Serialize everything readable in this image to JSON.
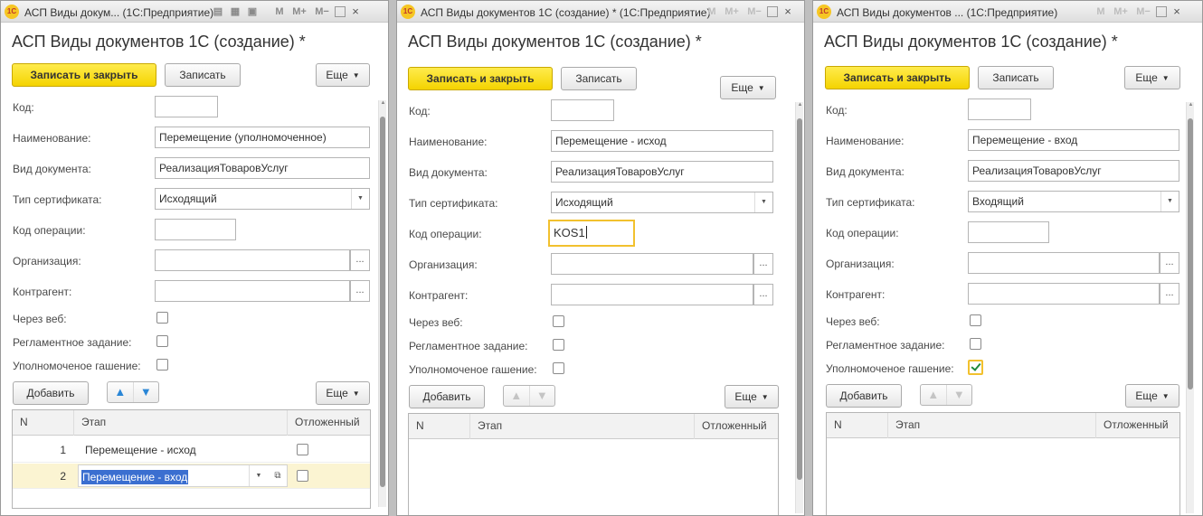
{
  "windows": [
    {
      "title_text": "АСП Виды докум...  (1С:Предприятие)",
      "form_title": "АСП Виды документов 1С (создание) *",
      "btn_save_close": "Записать и закрыть",
      "btn_save": "Записать",
      "btn_more": "Еще",
      "labels": {
        "code": "Код:",
        "name": "Наименование:",
        "doc_type": "Вид документа:",
        "cert_type": "Тип сертификата:",
        "op_code": "Код операции:",
        "org": "Организация:",
        "contractor": "Контрагент:",
        "via_web": "Через веб:",
        "scheduled": "Регламентное задание:",
        "auth_cancel": "Уполномоченое гашение:"
      },
      "values": {
        "code": "",
        "name": "Перемещение (уполномоченное)",
        "doc_type": "РеализацияТоваровУслуг",
        "cert_type": "Исходящий",
        "op_code": "",
        "org": "",
        "contractor": ""
      },
      "checks": {
        "via_web": false,
        "scheduled": false,
        "auth_cancel": false
      },
      "btn_add": "Добавить",
      "table": {
        "headers": [
          "N",
          "Этап",
          "Отложенный"
        ],
        "rows": [
          {
            "n": "1",
            "etap": "Перемещение - исход",
            "delayed": false
          },
          {
            "n": "2",
            "etap": "Перемещение - вход",
            "delayed": false
          }
        ]
      }
    },
    {
      "title_text": "АСП Виды документов 1С (создание) *  (1С:Предприятие)",
      "form_title": "АСП Виды документов 1С (создание) *",
      "btn_save_close": "Записать и закрыть",
      "btn_save": "Записать",
      "btn_more": "Еще",
      "labels": {
        "code": "Код:",
        "name": "Наименование:",
        "doc_type": "Вид документа:",
        "cert_type": "Тип сертификата:",
        "op_code": "Код операции:",
        "org": "Организация:",
        "contractor": "Контрагент:",
        "via_web": "Через веб:",
        "scheduled": "Регламентное задание:",
        "auth_cancel": "Уполномоченое гашение:"
      },
      "values": {
        "code": "",
        "name": "Перемещение - исход",
        "doc_type": "РеализацияТоваровУслуг",
        "cert_type": "Исходящий",
        "op_code": "KOS1",
        "org": "",
        "contractor": ""
      },
      "checks": {
        "via_web": false,
        "scheduled": false,
        "auth_cancel": false
      },
      "btn_add": "Добавить",
      "table": {
        "headers": [
          "N",
          "Этап",
          "Отложенный"
        ],
        "rows": []
      }
    },
    {
      "title_text": "АСП Виды документов ...  (1С:Предприятие)",
      "form_title": "АСП Виды документов 1С (создание) *",
      "btn_save_close": "Записать и закрыть",
      "btn_save": "Записать",
      "btn_more": "Еще",
      "labels": {
        "code": "Код:",
        "name": "Наименование:",
        "doc_type": "Вид документа:",
        "cert_type": "Тип сертификата:",
        "op_code": "Код операции:",
        "org": "Организация:",
        "contractor": "Контрагент:",
        "via_web": "Через веб:",
        "scheduled": "Регламентное задание:",
        "auth_cancel": "Уполномоченое гашение:"
      },
      "values": {
        "code": "",
        "name": "Перемещение - вход",
        "doc_type": "РеализацияТоваровУслуг",
        "cert_type": "Входящий",
        "op_code": "",
        "org": "",
        "contractor": ""
      },
      "checks": {
        "via_web": false,
        "scheduled": false,
        "auth_cancel": true
      },
      "btn_add": "Добавить",
      "table": {
        "headers": [
          "N",
          "Этап",
          "Отложенный"
        ],
        "rows": []
      }
    }
  ],
  "titlebar_icons": {
    "app": "1c-logo-icon",
    "memory": "M",
    "memory_plus": "M+",
    "memory_minus": "M−",
    "close": "×",
    "restore": "□"
  },
  "colors": {
    "primary_button": "#f4d300",
    "focus_border": "#f2c12e",
    "checkbox_tick": "#1f8a3a",
    "selection": "#3b6fd0"
  }
}
